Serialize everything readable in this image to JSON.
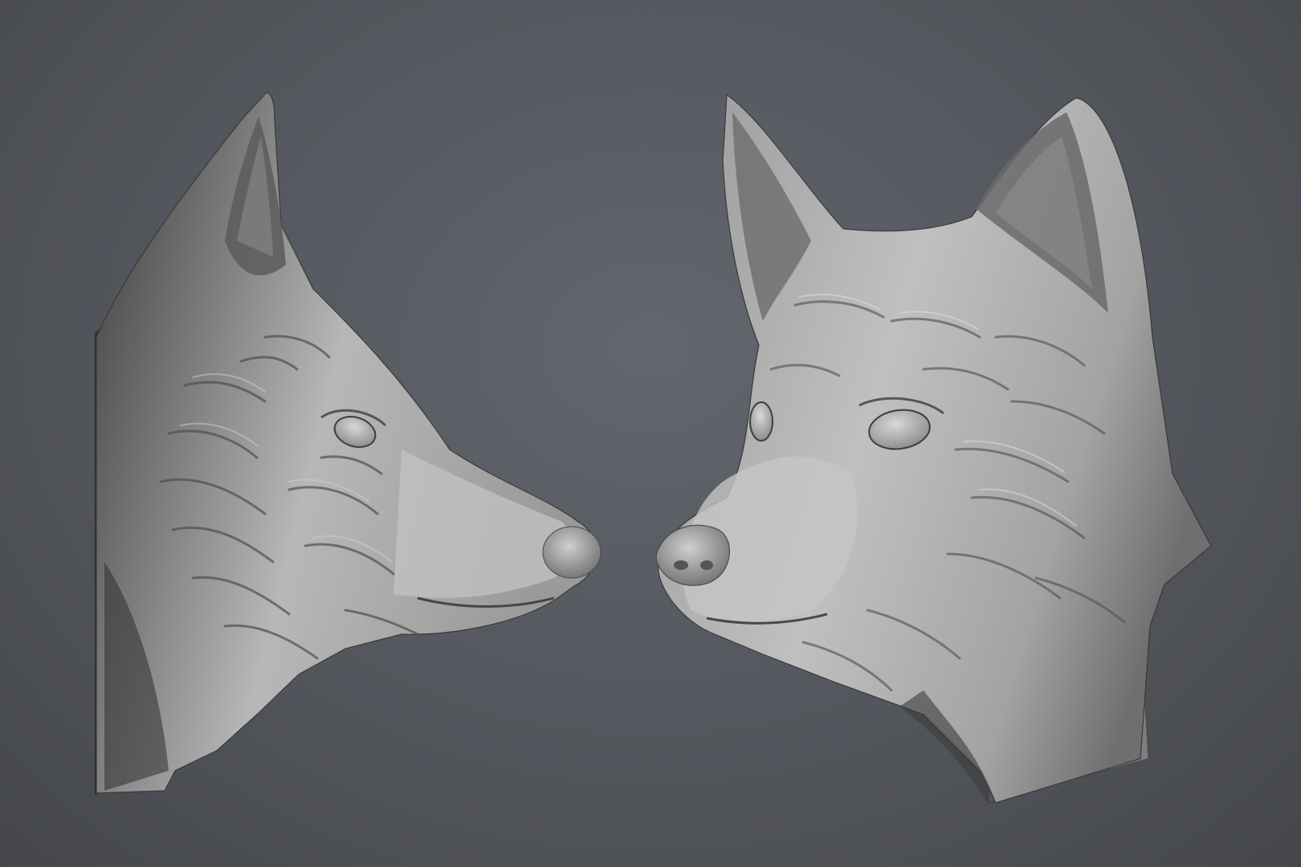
{
  "scene": {
    "background_color": "#55585e",
    "model_material_color": "#a9a9a9",
    "objects": [
      {
        "name": "fox-head-side-view"
      },
      {
        "name": "fox-head-three-quarter-view"
      }
    ]
  }
}
